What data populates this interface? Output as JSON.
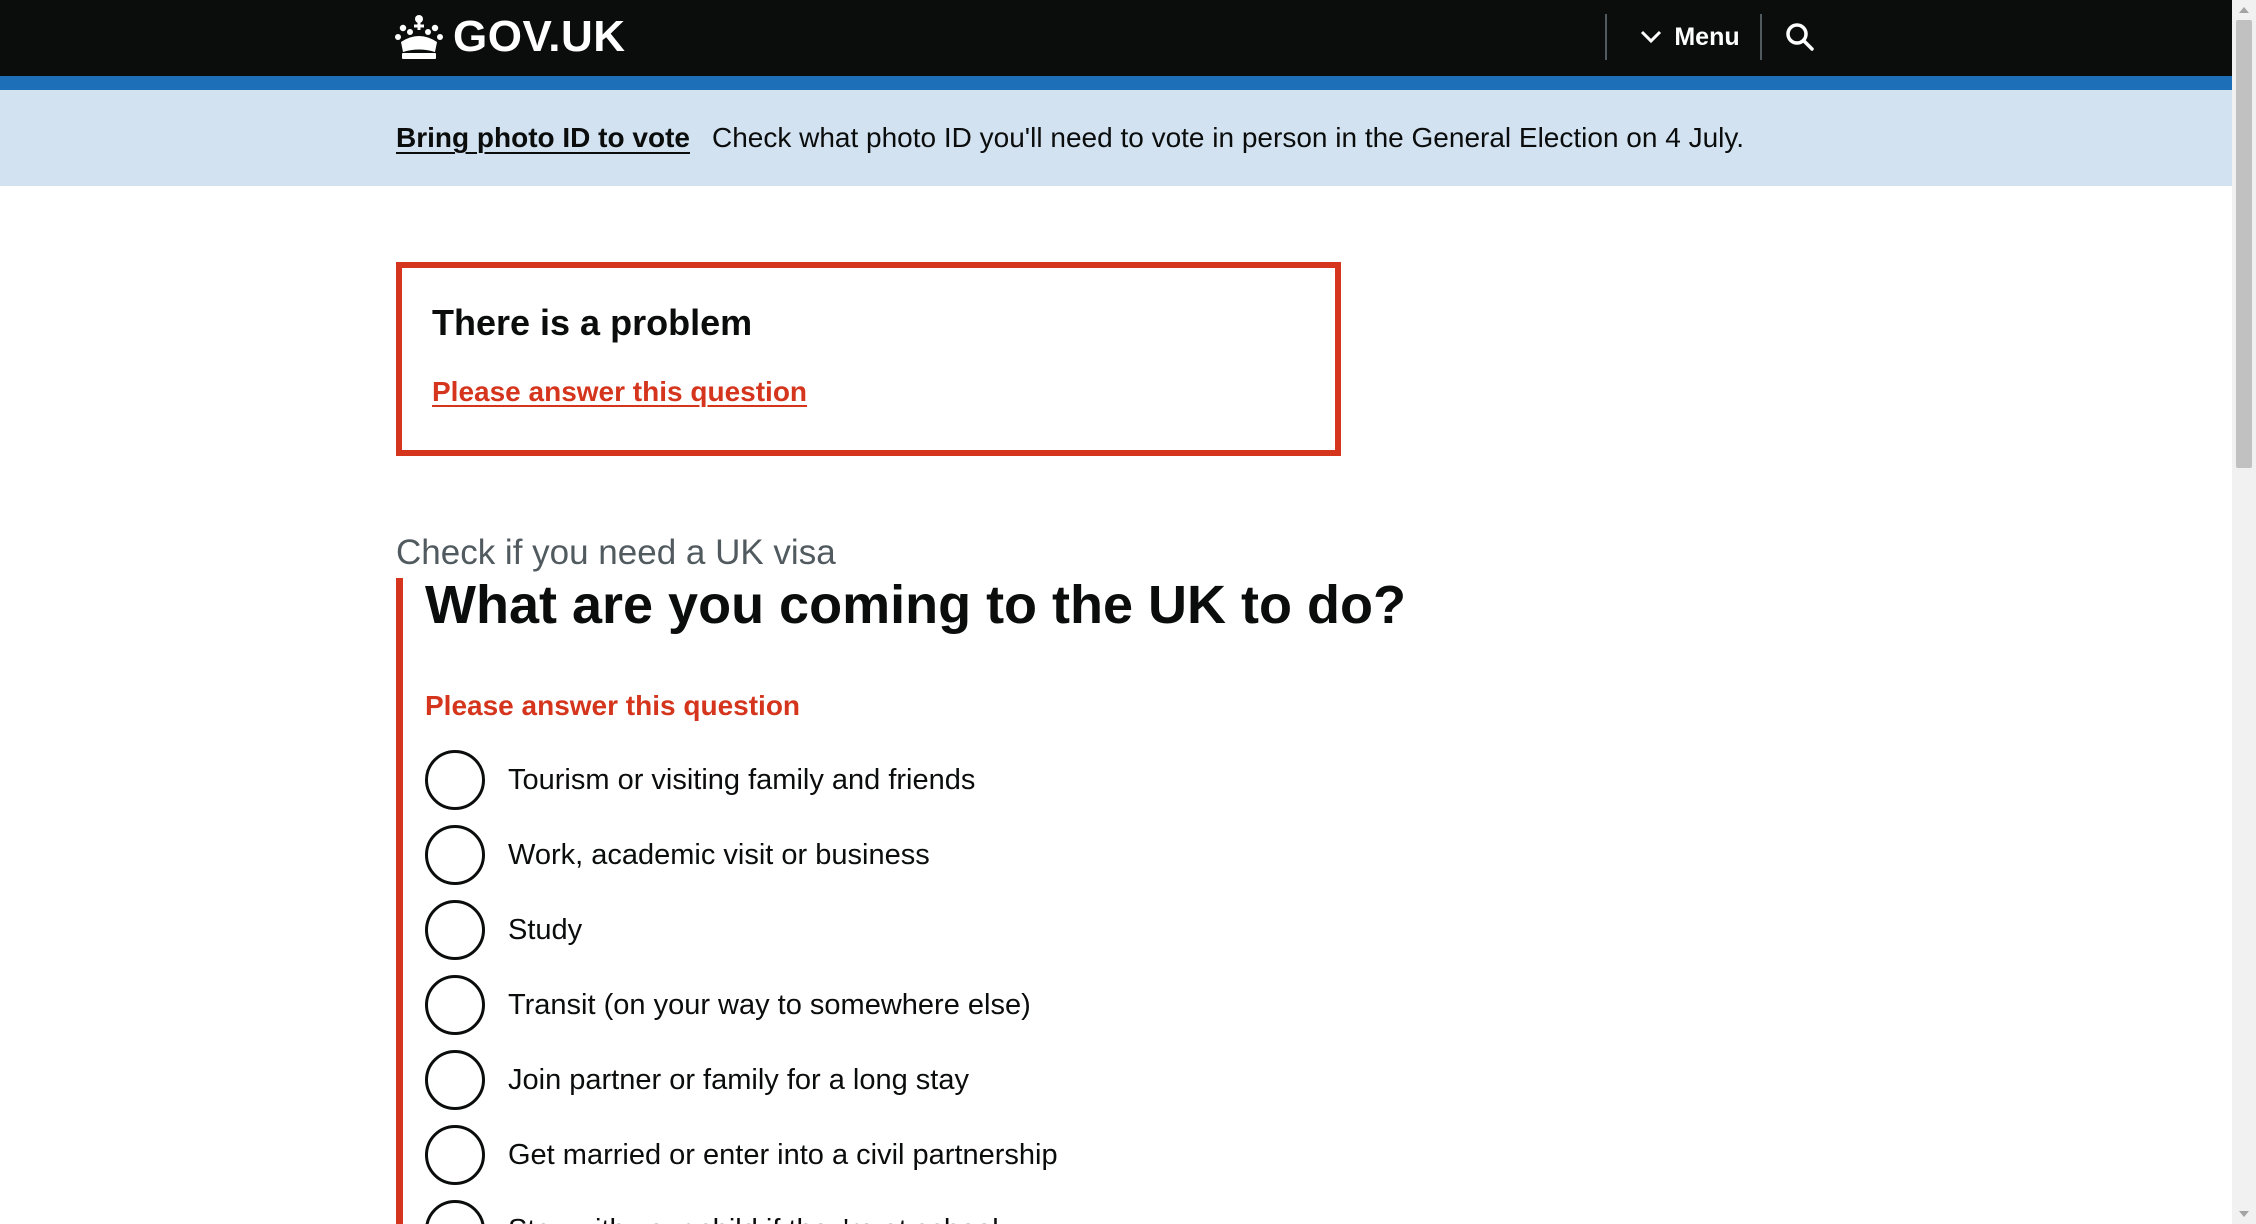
{
  "header": {
    "logo_text": "GOV.UK",
    "menu_label": "Menu",
    "search_icon": "search-icon",
    "colors": {
      "background": "#0b0c0c",
      "accent_bar": "#1d70b8"
    }
  },
  "banner": {
    "link_text": "Bring photo ID to vote",
    "message": "Check what photo ID you'll need to vote in person in the General Election on 4 July.",
    "background": "#d2e2f1"
  },
  "error_summary": {
    "title": "There is a problem",
    "link": "Please answer this question",
    "color": "#d4351c"
  },
  "question": {
    "caption": "Check if you need a UK visa",
    "heading": "What are you coming to the UK to do?",
    "error_message": "Please answer this question",
    "options": [
      "Tourism or visiting family and friends",
      "Work, academic visit or business",
      "Study",
      "Transit (on your way to somewhere else)",
      "Join partner or family for a long stay",
      "Get married or enter into a civil partnership",
      "Stay with your child if they're at school"
    ]
  }
}
